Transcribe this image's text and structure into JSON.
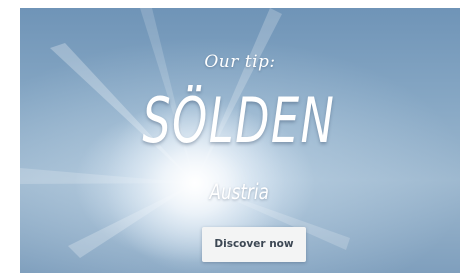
{
  "banner": {
    "tagline": "Our tip:",
    "title": "SÖLDEN",
    "subtitle": "Austria",
    "cta_label": "Discover now"
  },
  "colors": {
    "sky": "#86a7c4",
    "text": "#ffffff",
    "button_bg": "#f3f4f4",
    "button_text": "#3d4854"
  }
}
